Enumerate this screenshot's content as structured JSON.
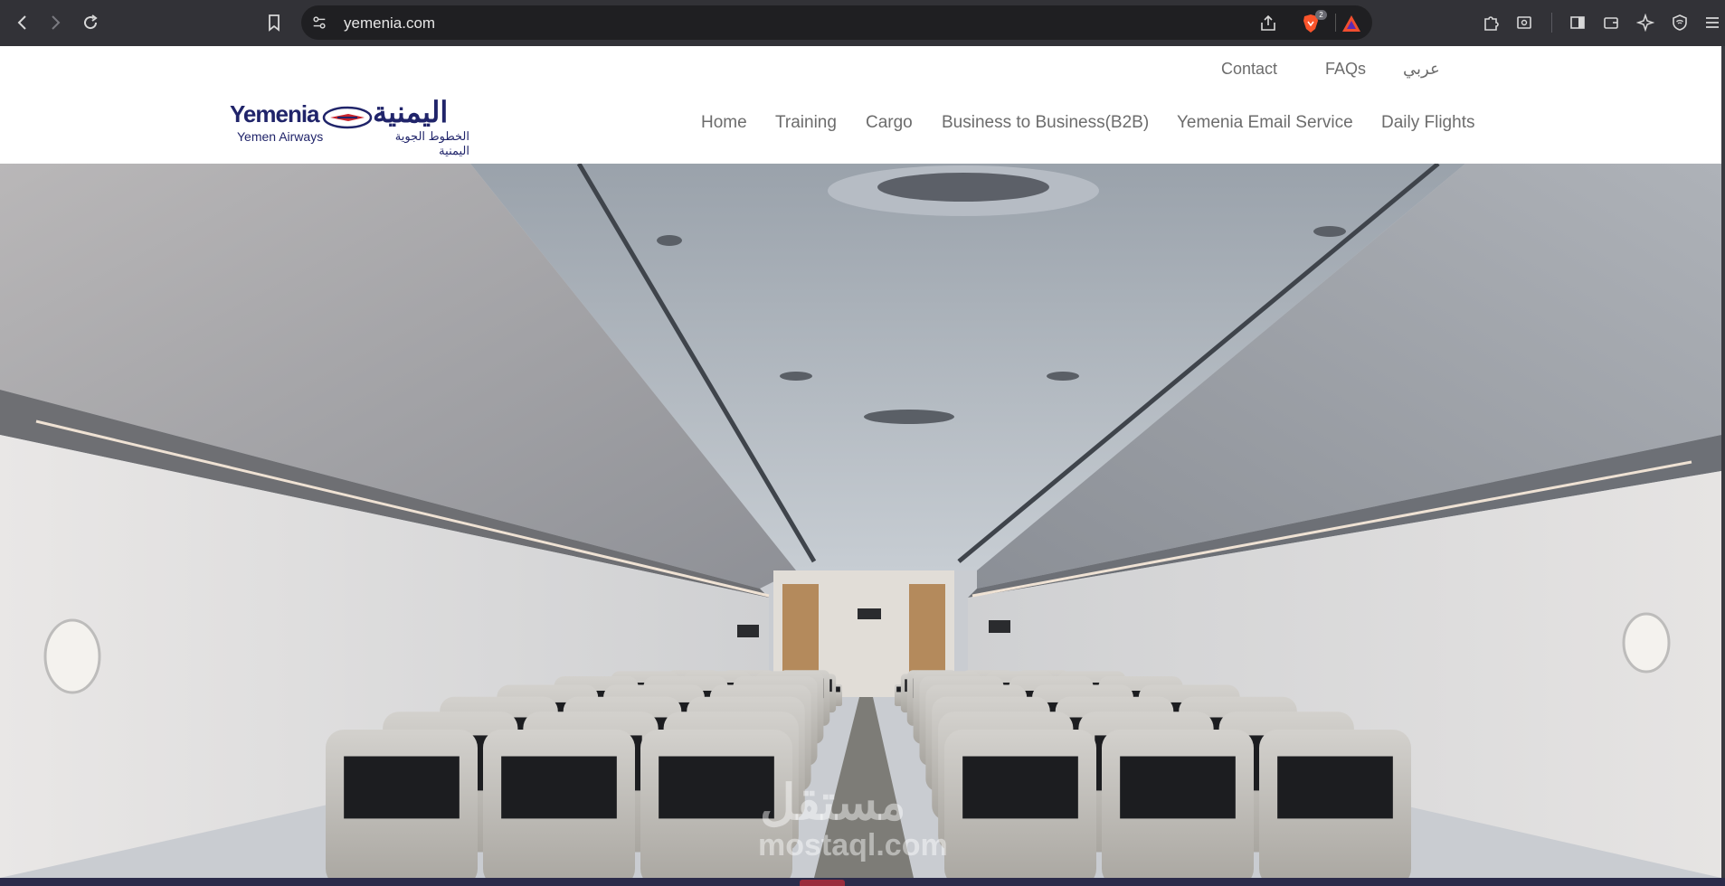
{
  "browser": {
    "url": "yemenia.com",
    "shields_badge": "2",
    "icons": {
      "back": "arrow-left-icon",
      "forward": "arrow-right-icon",
      "reload": "reload-icon",
      "bookmark": "bookmark-icon",
      "site_info": "site-settings-icon",
      "share": "share-icon",
      "brave_shields": "brave-lion-icon",
      "rewards": "rewards-triangle-icon",
      "extensions": "puzzle-icon",
      "reader": "reader-mode-icon",
      "sidebar": "sidebar-icon",
      "wallet": "wallet-icon",
      "leo": "sparkle-icon",
      "vpn": "vpn-shield-icon",
      "menu": "hamburger-menu-icon"
    },
    "colors": {
      "toolbar": "#323237",
      "urlbar": "#1f1f22"
    }
  },
  "site": {
    "logo": {
      "latin_title": "Yemenia",
      "latin_sub": "Yemen Airways",
      "arabic_title": "اليمنية",
      "arabic_sub": "الخطوط الجوية اليمنية"
    },
    "top_links": [
      "Contact",
      "FAQs",
      "عربي"
    ],
    "nav": [
      "Home",
      "Training",
      "Cargo",
      "Business to Business(B2B)",
      "Yemenia Email Service",
      "Daily Flights"
    ],
    "colors": {
      "brand": "#20246a",
      "nav_text": "#6c6c6c",
      "header_bg": "#ffffff"
    }
  },
  "hero": {
    "watermark_ar": "مستقل",
    "watermark_lat": "mostaql.com"
  }
}
